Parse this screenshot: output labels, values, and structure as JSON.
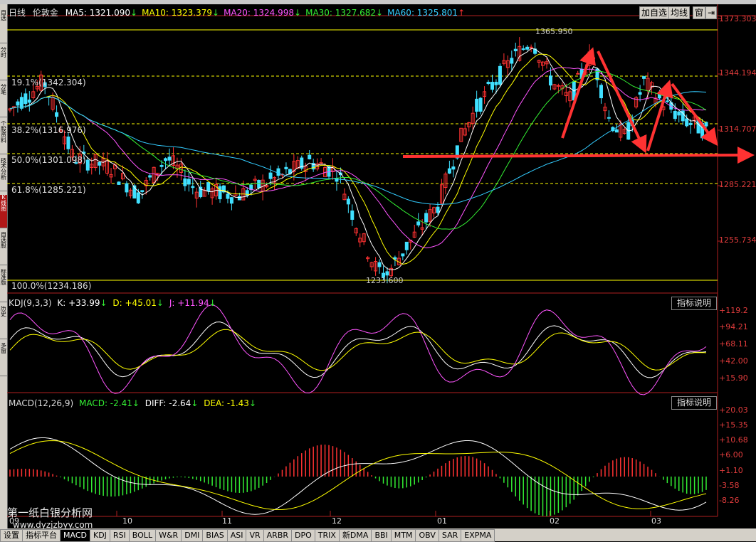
{
  "top_header": {
    "period": "日线",
    "name": "伦敦金",
    "ma": [
      {
        "label": "MA5: 1321.090",
        "arrow": "↓",
        "color": "#ffffff"
      },
      {
        "label": "MA10: 1323.379",
        "arrow": "↓",
        "color": "#ffff00"
      },
      {
        "label": "MA20: 1324.998",
        "arrow": "↓",
        "color": "#ff55ff"
      },
      {
        "label": "MA30: 1327.682",
        "arrow": "↓",
        "color": "#33ee33"
      },
      {
        "label": "MA60: 1325.801",
        "arrow": "↑",
        "color": "#33ccff"
      }
    ],
    "buttons": {
      "add": "加自选",
      "junxian": "均线",
      "window": "窗",
      "exit": "⇥"
    }
  },
  "price_axis": [
    "1373.303",
    "1344.194",
    "1314.707",
    "1285.221",
    "1255.734"
  ],
  "fib_levels": [
    "19.1%(1342.304)",
    "38.2%(1316.976)",
    "50.0%(1301.098)",
    "61.8%(1285.221)",
    "100.0%(1234.186)"
  ],
  "price_marks": {
    "high": "1365.950",
    "low": "1233.600"
  },
  "kdj": {
    "name": "KDJ(9,3,3)",
    "k": "K: +33.99",
    "k_arrow": "↓",
    "d": "D: +45.01",
    "d_arrow": "↓",
    "j": "J: +11.94",
    "j_arrow": "↓",
    "button": "指标说明",
    "axis": [
      "+119.2",
      "+94.21",
      "+68.11",
      "+42.00",
      "+15.90"
    ]
  },
  "macd": {
    "name": "MACD(12,26,9)",
    "macd": "MACD: -2.41",
    "macd_arrow": "↓",
    "diff": "DIFF: -2.64",
    "diff_arrow": "↓",
    "dea": "DEA: -1.43",
    "dea_arrow": "↓",
    "button": "指标说明",
    "axis": [
      "+20.03",
      "+15.35",
      "+10.68",
      "+6.00",
      "+1.10",
      "-3.58",
      "-8.26"
    ]
  },
  "months": [
    "09",
    "10",
    "11",
    "12",
    "01",
    "02",
    "03"
  ],
  "watermark": {
    "title": "第一纸白银分析网",
    "url": "www.dyzjzbyy.com"
  },
  "sidebar_tabs": [
    "自选",
    "分时",
    "分笔",
    "个股资料",
    "技术分析",
    "K线图",
    "自选股",
    "标准版",
    "历史",
    "多窗"
  ],
  "bottom_tabs": [
    "设置",
    "指标平台",
    "MACD",
    "KDJ",
    "RSI",
    "BOLL",
    "W&R",
    "DMI",
    "BIAS",
    "ASI",
    "VR",
    "ARBR",
    "DPO",
    "TRIX",
    "新DMA",
    "BBI",
    "MTM",
    "OBV",
    "SAR",
    "EXPMA"
  ],
  "colors": {
    "up": "#ff3232",
    "down": "#40e0ff",
    "accent": "#ff3232",
    "fib": "#ffff00"
  }
}
